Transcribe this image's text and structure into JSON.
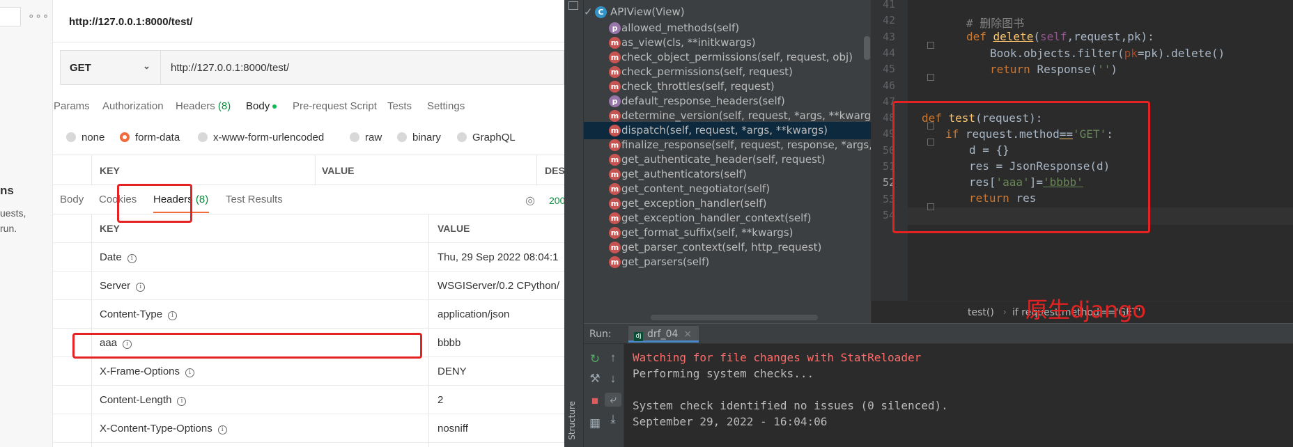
{
  "sidebar": {
    "dots": "∘∘∘",
    "heading": "ns",
    "line1": "uests,",
    "line2": "run."
  },
  "request": {
    "title": "http://127.0.0.1:8000/test/",
    "method": "GET",
    "url": "http://127.0.0.1:8000/test/",
    "tabs": [
      {
        "label": "Params"
      },
      {
        "label": "Authorization"
      },
      {
        "label": "Headers",
        "count": "(8)"
      },
      {
        "label": "Body"
      },
      {
        "label": "Pre-request Script"
      },
      {
        "label": "Tests"
      },
      {
        "label": "Settings"
      }
    ],
    "body_types": [
      "none",
      "form-data",
      "x-www-form-urlencoded",
      "raw",
      "binary",
      "GraphQL"
    ],
    "body_columns": [
      "KEY",
      "VALUE",
      "DES"
    ]
  },
  "response": {
    "tabs": [
      {
        "label": "Body"
      },
      {
        "label": "Cookies"
      },
      {
        "label": "Headers",
        "count": "(8)"
      },
      {
        "label": "Test Results"
      }
    ],
    "status": "200",
    "columns": [
      "KEY",
      "VALUE"
    ],
    "headers": [
      {
        "key": "Date",
        "value": "Thu, 29 Sep 2022 08:04:1"
      },
      {
        "key": "Server",
        "value": "WSGIServer/0.2 CPython/"
      },
      {
        "key": "Content-Type",
        "value": "application/json"
      },
      {
        "key": "aaa",
        "value": "bbbb"
      },
      {
        "key": "X-Frame-Options",
        "value": "DENY"
      },
      {
        "key": "Content-Length",
        "value": "2"
      },
      {
        "key": "X-Content-Type-Options",
        "value": "nosniff"
      }
    ]
  },
  "structure": {
    "root": {
      "icon": "C",
      "label": "APIView(View)"
    },
    "items": [
      {
        "icon": "p",
        "label": "allowed_methods(self)"
      },
      {
        "icon": "m",
        "label": "as_view(cls, **initkwargs)"
      },
      {
        "icon": "m",
        "label": "check_object_permissions(self, request, obj)"
      },
      {
        "icon": "m",
        "label": "check_permissions(self, request)"
      },
      {
        "icon": "m",
        "label": "check_throttles(self, request)"
      },
      {
        "icon": "p",
        "label": "default_response_headers(self)"
      },
      {
        "icon": "m",
        "label": "determine_version(self, request, *args, **kwargs)"
      },
      {
        "icon": "m",
        "label": "dispatch(self, request, *args, **kwargs)",
        "selected": true
      },
      {
        "icon": "m",
        "label": "finalize_response(self, request, response, *args,"
      },
      {
        "icon": "m",
        "label": "get_authenticate_header(self, request)"
      },
      {
        "icon": "m",
        "label": "get_authenticators(self)"
      },
      {
        "icon": "m",
        "label": "get_content_negotiator(self)"
      },
      {
        "icon": "m",
        "label": "get_exception_handler(self)"
      },
      {
        "icon": "m",
        "label": "get_exception_handler_context(self)"
      },
      {
        "icon": "m",
        "label": "get_format_suffix(self, **kwargs)"
      },
      {
        "icon": "m",
        "label": "get_parser_context(self, http_request)"
      },
      {
        "icon": "m",
        "label": "get_parsers(self)"
      }
    ]
  },
  "editor": {
    "line_numbers": [
      "41",
      "42",
      "43",
      "44",
      "45",
      "46",
      "47",
      "48",
      "49",
      "50",
      "51",
      "52",
      "53",
      "54"
    ],
    "current_line": "52",
    "code": {
      "l42_comment": "# 删除图书",
      "l43_def": "def ",
      "l43_name": "delete",
      "l43_open": "(",
      "l43_self": "self",
      "l43_args": ",request,pk):",
      "l44_a": "Book.objects.filter(",
      "l44_pk": "pk",
      "l44_b": "=pk).delete()",
      "l45_ret": "return ",
      "l45_b": "Response(",
      "l45_str": "''",
      "l45_c": ")",
      "l48_def": "def ",
      "l48_name": "test",
      "l48_args": "(request):",
      "l49_if": "if ",
      "l49_a": "request.method",
      "l49_eq": "==",
      "l49_str": "'GET'",
      "l49_c": ":",
      "l50": "d = {}",
      "l51": "res = JsonResponse(d)",
      "l52_a": "res[",
      "l52_key": "'aaa'",
      "l52_b": "]=",
      "l52_val": "'bbbb'",
      "l53_ret": "return ",
      "l53_b": "res"
    },
    "breadcrumb": [
      "test()",
      "if request.method=='GET'"
    ]
  },
  "annotation": "原生django",
  "run": {
    "label": "Run:",
    "tab": "drf_04",
    "console": [
      "Watching for file changes with StatReloader",
      "Performing system checks...",
      "",
      "System check identified no issues (0 silenced).",
      "September 29, 2022 - 16:04:06"
    ],
    "structure_label": "Structure"
  }
}
